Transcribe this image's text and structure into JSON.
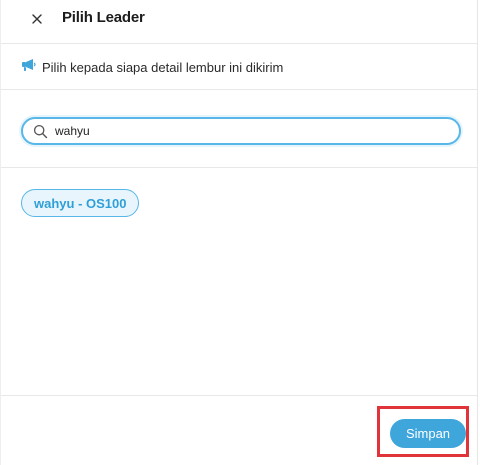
{
  "dialog": {
    "title": "Pilih Leader",
    "close_icon": "close-icon"
  },
  "info": {
    "icon": "megaphone-icon",
    "text": "Pilih kepada siapa detail lembur ini dikirim"
  },
  "search": {
    "icon": "search-icon",
    "value": "wahyu",
    "placeholder": ""
  },
  "results": {
    "items": [
      {
        "label": "wahyu - OS100",
        "selected": true
      }
    ]
  },
  "footer": {
    "save_label": "Simpan"
  },
  "colors": {
    "accent": "#3fa6dc",
    "chip_bg": "#e8f5fc",
    "chip_text": "#2f9fd8",
    "highlight": "#e0343a"
  }
}
